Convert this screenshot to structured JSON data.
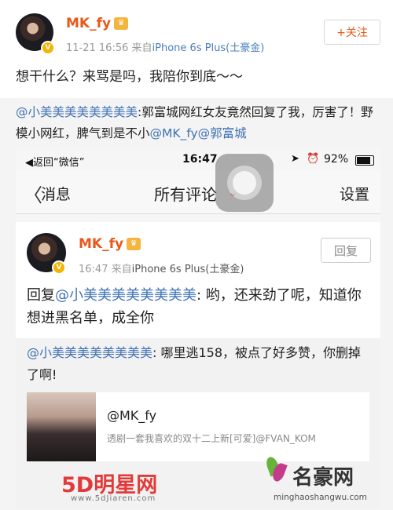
{
  "post": {
    "username": "MK_fy",
    "time": "11-21 16:56",
    "from_prefix": "来自",
    "source": "iPhone 6s Plus(土豪金)",
    "follow_label": "+关注",
    "text": "想干什么？来骂是吗，我陪你到底～～"
  },
  "retweet": {
    "mention1": "@小美美美美美美美美",
    "text1": ":郭富城网红女友竟然回复了我，厉害了！野模小网红，脾气到是不小",
    "mention2": "@MK_fy",
    "mention3": "@郭富城"
  },
  "phone": {
    "status_back": "◀返回“微信”",
    "status_time": "16:47",
    "status_battery": "92%",
    "nav_back": "消息",
    "nav_title": "所有评论",
    "nav_settings": "设置"
  },
  "comment": {
    "username": "MK_fy",
    "time": "16:47",
    "from_prefix": "来自",
    "source": "iPhone 6s Plus(土豪金)",
    "reply_button": "回复",
    "reply_prefix": "回复",
    "reply_mention": "@小美美美美美美美美",
    "reply_text": ": 哟，还来劲了呢，知道你想进黑名单，成全你"
  },
  "quoted": {
    "mention": "@小美美美美美美美美",
    "text": ": 哪里逃158，被点了好多赞，你删掉了啊!"
  },
  "linked_post": {
    "username": "@MK_fy",
    "snippet": "透剧一套我喜欢的双十二上新[可爱]@FVAN_KOM"
  },
  "watermarks": {
    "left_logo": "5D明星网",
    "left_url": "www.5dJiaren.com",
    "right_logo": "名豪网",
    "right_url": "minghaoshangwu.com"
  },
  "colors": {
    "username": "#e8581b",
    "link": "#3f72b5",
    "follow": "#e8581b"
  }
}
